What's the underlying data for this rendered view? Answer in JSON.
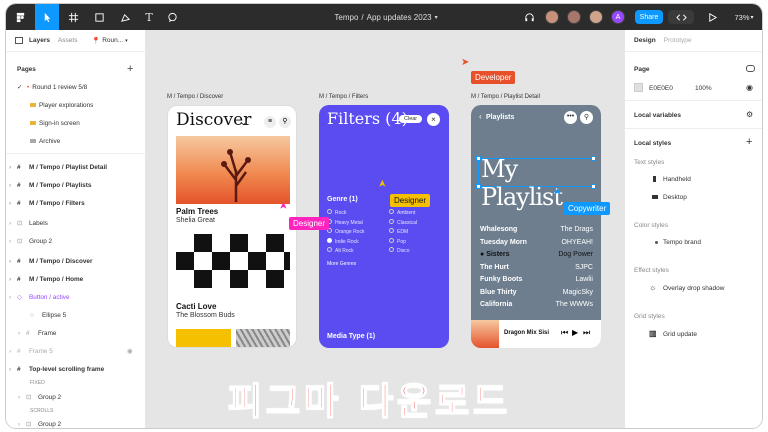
{
  "toolbar": {
    "title_path": "Tempo",
    "title_sep": "/",
    "title_file": "App updates 2023",
    "share": "Share",
    "zoom": "73%",
    "avatar_initial": "A",
    "colors": {
      "accent": "#0d99ff",
      "bg": "#2c2c2c",
      "avatar_a": "#9747ff"
    }
  },
  "left_panel": {
    "tabs": [
      "Layers",
      "Assets",
      "Roun..."
    ],
    "pages_heading": "Pages",
    "pages": [
      "Round 1 review 5/8",
      "Player explorations",
      "Sign-in screen",
      "Archive"
    ],
    "layers": [
      "M / Tempo / Playlist Detail",
      "M / Tempo / Playlists",
      "M / Tempo / Filters",
      "Labels",
      "Group 2",
      "M / Tempo / Discover",
      "M / Tempo / Home",
      "Button / active",
      "Ellipse 5",
      "Frame",
      "Frame 5",
      "Top-level scrolling frame",
      "FIXED",
      "Group 2",
      "SCROLLS",
      "Group 2"
    ]
  },
  "canvas": {
    "frame_labels": [
      "M / Tempo / Discover",
      "M / Tempo / Filters",
      "M / Tempo / Playlist Detail"
    ],
    "discover": {
      "title": "Discover",
      "item1_title": "Palm Trees",
      "item1_artist": "Shelia Great",
      "item2_title": "Cacti Love",
      "item2_artist": "The Blossom Buds"
    },
    "filters": {
      "title": "Filters (4)",
      "clear": "Clear",
      "genre": "Genre (1)",
      "col1": [
        "Rock",
        "Heavy Metal",
        "Orange Rock",
        "Indie Rock",
        "Alt Rock"
      ],
      "col2": [
        "Ambient",
        "Classical",
        "EDM",
        "Pop",
        "Disco"
      ],
      "more": "More Genres",
      "media": "Media Type (1)"
    },
    "playlist": {
      "back": "Playlists",
      "title": "My Playlist",
      "rows": [
        [
          "Whalesong",
          "The Drags"
        ],
        [
          "Tuesday Morn",
          "OHYEAH!"
        ],
        [
          "Sisters",
          "Dog Power"
        ],
        [
          "The Hurt",
          "SJPC"
        ],
        [
          "Funky Boots",
          "Lawlii"
        ],
        [
          "Blue Thirty",
          "MagicSky"
        ],
        [
          "California",
          "The WWWs"
        ]
      ],
      "now_playing": "Dragon Mix Sisi"
    },
    "cursors": {
      "developer": "Developer",
      "designer1": "Designer",
      "designer2": "Designer",
      "copywriter": "Copywriter"
    },
    "korean": "피그마 다운로드"
  },
  "right_panel": {
    "tabs": [
      "Design",
      "Prototype"
    ],
    "page": "Page",
    "page_hex": "E0E0E0",
    "page_opacity": "100%",
    "local_variables": "Local variables",
    "local_styles": "Local styles",
    "text_styles": "Text styles",
    "text_items": [
      "Handheld",
      "Desktop"
    ],
    "color_styles": "Color styles",
    "color_items": [
      "Tempo brand"
    ],
    "effect_styles": "Effect styles",
    "effect_items": [
      "Overlay drop shadow"
    ],
    "grid_styles": "Grid styles",
    "grid_items": [
      "Grid update"
    ]
  }
}
